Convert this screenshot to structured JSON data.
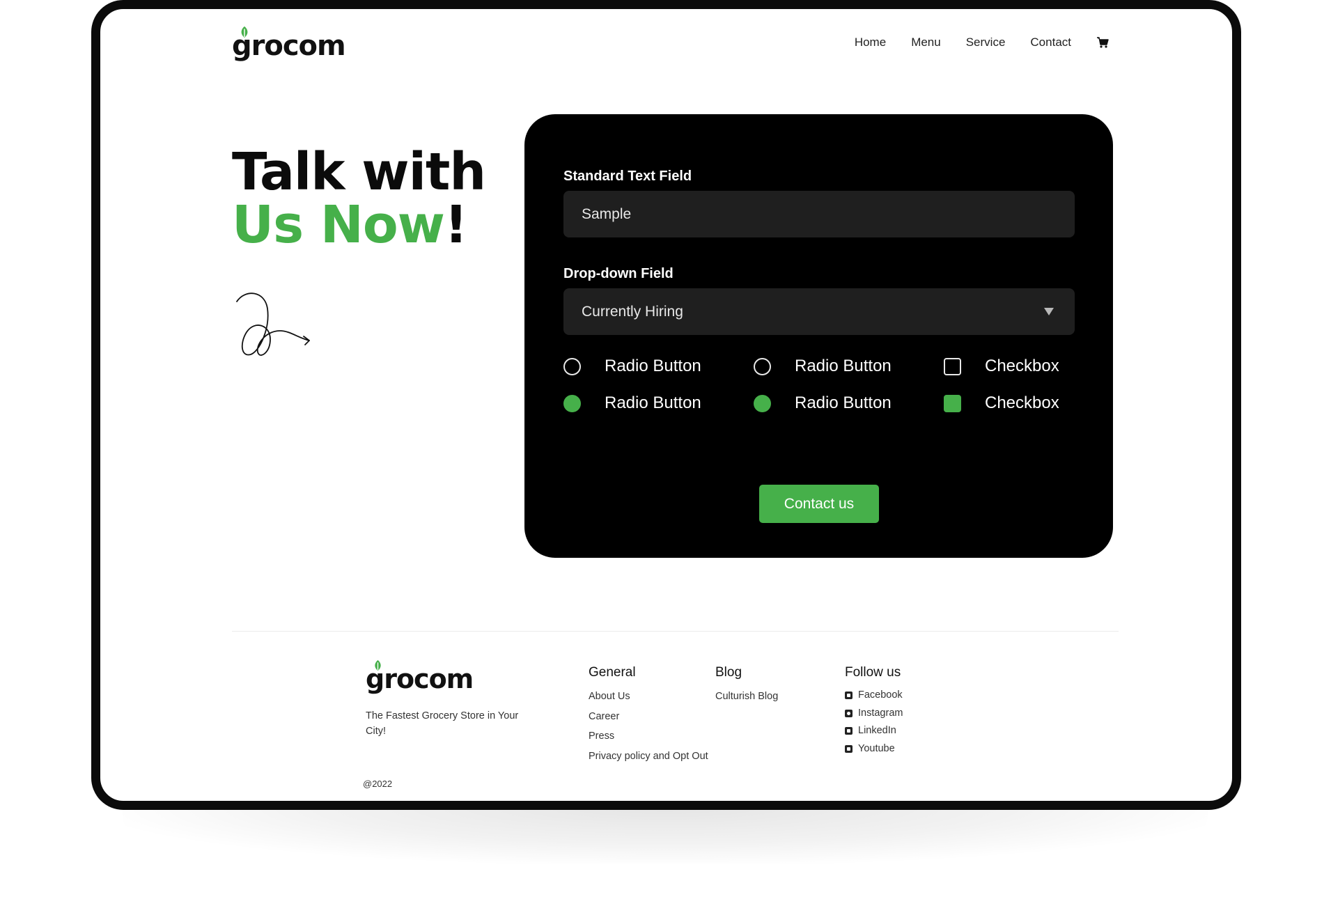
{
  "brand": {
    "name": "grocom",
    "accent": "#46b04a"
  },
  "nav": {
    "items": [
      "Home",
      "Menu",
      "Service",
      "Contact"
    ],
    "cart_icon": "cart-icon"
  },
  "hero": {
    "line1": "Talk with",
    "line2_green": "Us Now",
    "line2_end": "!"
  },
  "form": {
    "text_label": "Standard Text Field",
    "text_value": "Sample",
    "dropdown_label": "Drop-down Field",
    "dropdown_value": "Currently Hiring",
    "radio_1": "Radio Button",
    "radio_2": "Radio Button",
    "radio_3": "Radio Button",
    "radio_4": "Radio Button",
    "checkbox_1": "Checkbox",
    "checkbox_2": "Checkbox",
    "submit": "Contact us"
  },
  "footer": {
    "tagline": "The Fastest Grocery Store in Your City!",
    "copyright": "@2022",
    "general": {
      "title": "General",
      "links": [
        "About Us",
        "Career",
        "Press",
        "Privacy policy and Opt Out"
      ]
    },
    "blog": {
      "title": "Blog",
      "links": [
        "Culturish Blog"
      ]
    },
    "follow": {
      "title": "Follow us",
      "links": [
        "Facebook",
        "Instagram",
        "LinkedIn",
        "Youtube"
      ]
    }
  }
}
